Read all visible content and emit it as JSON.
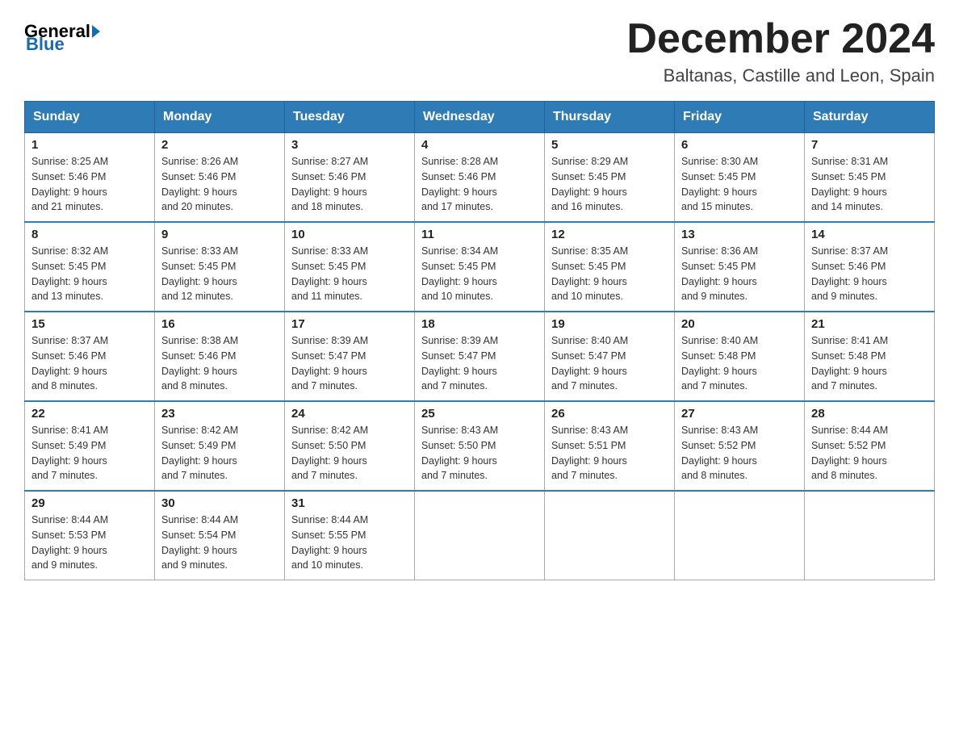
{
  "header": {
    "logo": {
      "general": "General",
      "blue": "Blue"
    },
    "month_year": "December 2024",
    "location": "Baltanas, Castille and Leon, Spain"
  },
  "days_of_week": [
    "Sunday",
    "Monday",
    "Tuesday",
    "Wednesday",
    "Thursday",
    "Friday",
    "Saturday"
  ],
  "weeks": [
    [
      {
        "day": "1",
        "sunrise": "8:25 AM",
        "sunset": "5:46 PM",
        "daylight": "9 hours and 21 minutes."
      },
      {
        "day": "2",
        "sunrise": "8:26 AM",
        "sunset": "5:46 PM",
        "daylight": "9 hours and 20 minutes."
      },
      {
        "day": "3",
        "sunrise": "8:27 AM",
        "sunset": "5:46 PM",
        "daylight": "9 hours and 18 minutes."
      },
      {
        "day": "4",
        "sunrise": "8:28 AM",
        "sunset": "5:46 PM",
        "daylight": "9 hours and 17 minutes."
      },
      {
        "day": "5",
        "sunrise": "8:29 AM",
        "sunset": "5:45 PM",
        "daylight": "9 hours and 16 minutes."
      },
      {
        "day": "6",
        "sunrise": "8:30 AM",
        "sunset": "5:45 PM",
        "daylight": "9 hours and 15 minutes."
      },
      {
        "day": "7",
        "sunrise": "8:31 AM",
        "sunset": "5:45 PM",
        "daylight": "9 hours and 14 minutes."
      }
    ],
    [
      {
        "day": "8",
        "sunrise": "8:32 AM",
        "sunset": "5:45 PM",
        "daylight": "9 hours and 13 minutes."
      },
      {
        "day": "9",
        "sunrise": "8:33 AM",
        "sunset": "5:45 PM",
        "daylight": "9 hours and 12 minutes."
      },
      {
        "day": "10",
        "sunrise": "8:33 AM",
        "sunset": "5:45 PM",
        "daylight": "9 hours and 11 minutes."
      },
      {
        "day": "11",
        "sunrise": "8:34 AM",
        "sunset": "5:45 PM",
        "daylight": "9 hours and 10 minutes."
      },
      {
        "day": "12",
        "sunrise": "8:35 AM",
        "sunset": "5:45 PM",
        "daylight": "9 hours and 10 minutes."
      },
      {
        "day": "13",
        "sunrise": "8:36 AM",
        "sunset": "5:45 PM",
        "daylight": "9 hours and 9 minutes."
      },
      {
        "day": "14",
        "sunrise": "8:37 AM",
        "sunset": "5:46 PM",
        "daylight": "9 hours and 9 minutes."
      }
    ],
    [
      {
        "day": "15",
        "sunrise": "8:37 AM",
        "sunset": "5:46 PM",
        "daylight": "9 hours and 8 minutes."
      },
      {
        "day": "16",
        "sunrise": "8:38 AM",
        "sunset": "5:46 PM",
        "daylight": "9 hours and 8 minutes."
      },
      {
        "day": "17",
        "sunrise": "8:39 AM",
        "sunset": "5:47 PM",
        "daylight": "9 hours and 7 minutes."
      },
      {
        "day": "18",
        "sunrise": "8:39 AM",
        "sunset": "5:47 PM",
        "daylight": "9 hours and 7 minutes."
      },
      {
        "day": "19",
        "sunrise": "8:40 AM",
        "sunset": "5:47 PM",
        "daylight": "9 hours and 7 minutes."
      },
      {
        "day": "20",
        "sunrise": "8:40 AM",
        "sunset": "5:48 PM",
        "daylight": "9 hours and 7 minutes."
      },
      {
        "day": "21",
        "sunrise": "8:41 AM",
        "sunset": "5:48 PM",
        "daylight": "9 hours and 7 minutes."
      }
    ],
    [
      {
        "day": "22",
        "sunrise": "8:41 AM",
        "sunset": "5:49 PM",
        "daylight": "9 hours and 7 minutes."
      },
      {
        "day": "23",
        "sunrise": "8:42 AM",
        "sunset": "5:49 PM",
        "daylight": "9 hours and 7 minutes."
      },
      {
        "day": "24",
        "sunrise": "8:42 AM",
        "sunset": "5:50 PM",
        "daylight": "9 hours and 7 minutes."
      },
      {
        "day": "25",
        "sunrise": "8:43 AM",
        "sunset": "5:50 PM",
        "daylight": "9 hours and 7 minutes."
      },
      {
        "day": "26",
        "sunrise": "8:43 AM",
        "sunset": "5:51 PM",
        "daylight": "9 hours and 7 minutes."
      },
      {
        "day": "27",
        "sunrise": "8:43 AM",
        "sunset": "5:52 PM",
        "daylight": "9 hours and 8 minutes."
      },
      {
        "day": "28",
        "sunrise": "8:44 AM",
        "sunset": "5:52 PM",
        "daylight": "9 hours and 8 minutes."
      }
    ],
    [
      {
        "day": "29",
        "sunrise": "8:44 AM",
        "sunset": "5:53 PM",
        "daylight": "9 hours and 9 minutes."
      },
      {
        "day": "30",
        "sunrise": "8:44 AM",
        "sunset": "5:54 PM",
        "daylight": "9 hours and 9 minutes."
      },
      {
        "day": "31",
        "sunrise": "8:44 AM",
        "sunset": "5:55 PM",
        "daylight": "9 hours and 10 minutes."
      },
      null,
      null,
      null,
      null
    ]
  ],
  "labels": {
    "sunrise": "Sunrise:",
    "sunset": "Sunset:",
    "daylight": "Daylight:"
  }
}
